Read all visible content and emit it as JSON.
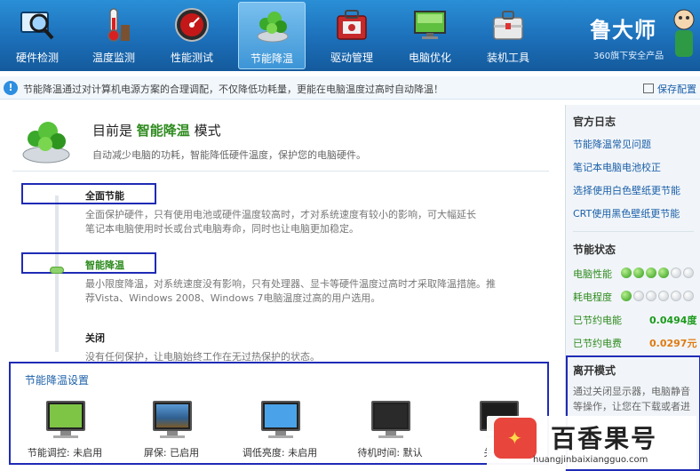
{
  "toolbar": {
    "tools": [
      {
        "label": "硬件检测",
        "icon": "magnifier-icon"
      },
      {
        "label": "温度监测",
        "icon": "thermometer-icon"
      },
      {
        "label": "性能测试",
        "icon": "speedometer-icon"
      },
      {
        "label": "节能降温",
        "icon": "leaf-cooling-icon"
      },
      {
        "label": "驱动管理",
        "icon": "driver-toolbox-icon"
      },
      {
        "label": "电脑优化",
        "icon": "optimize-monitor-icon"
      },
      {
        "label": "装机工具",
        "icon": "toolbox-icon"
      }
    ],
    "active_index": 3,
    "brand_name": "鲁大师",
    "brand_sub": "360旗下安全产品"
  },
  "infobar": {
    "message": "节能降温通过对计算机电源方案的合理调配，不仅降低功耗量，更能在电脑温度过高时自动降温！",
    "save_link": "保存配置"
  },
  "main": {
    "mode_prefix": "目前是",
    "mode_name": "智能降温",
    "mode_suffix": "模式",
    "mode_desc": "自动减少电脑的功耗，智能降低硬件温度，保护您的电脑硬件。",
    "options": [
      {
        "title": "全面节能",
        "desc_lines": [
          "全面保护硬件，只有使用电池或硬件温度较高时，才对系统速度有较小的影响，可大幅延长",
          "笔记本电脑使用时长或台式电脑寿命，同时也让电脑更加稳定。"
        ]
      },
      {
        "title": "智能降温",
        "desc_lines": [
          "最小限度降温，对系统速度没有影响，只有处理器、显卡等硬件温度过高时才采取降温措施。推",
          "荐Vista、Windows 2008、Windows 7电脑温度过高的用户选用。"
        ]
      },
      {
        "title": "关闭",
        "desc_lines": [
          "没有任何保护，让电脑始终工作在无过热保护的状态。"
        ]
      }
    ]
  },
  "settings": {
    "title": "节能降温设置",
    "items": [
      {
        "label": "节能调控: 未启用",
        "screen": "#7ec545"
      },
      {
        "label": "屏保: 已启用",
        "screen": "#3c6fa8"
      },
      {
        "label": "调低亮度: 未启用",
        "screen": "#4aa3e8"
      },
      {
        "label": "待机时间: 默认",
        "screen": "#2a2a2a"
      },
      {
        "label": "关闭显",
        "screen": "#1c1c1c"
      }
    ]
  },
  "sidebar": {
    "log_title": "官方日志",
    "log_links": [
      "节能降温常见问题",
      "笔记本电脑电池校正",
      "选择使用白色壁纸更节能",
      "CRT使用黑色壁纸更节能"
    ],
    "status_title": "节能状态",
    "power_label": "电脑性能",
    "power_level": 4,
    "heat_label": "耗电程度",
    "heat_level": 1,
    "dot_total": 6,
    "saved_power_label": "已节约电能",
    "saved_power_value": "0.0494度",
    "saved_cost_label": "已节约电费",
    "saved_cost_value": "0.0297元",
    "box_title": "离开模式",
    "box_lines": [
      "通过关闭显示器，电脑静音",
      "等操作，让您在下载或者进"
    ]
  },
  "watermark": {
    "title": "百香果号",
    "url": "huangjinbaixiangguo.com"
  },
  "colors": {
    "toolbar_top": "#2a8fd6",
    "toolbar_bottom": "#145a9c",
    "highlight_box": "#1f2bb5",
    "green": "#2e8b1e",
    "saved_power": "#1a9a1a",
    "saved_cost": "#e07a10"
  }
}
